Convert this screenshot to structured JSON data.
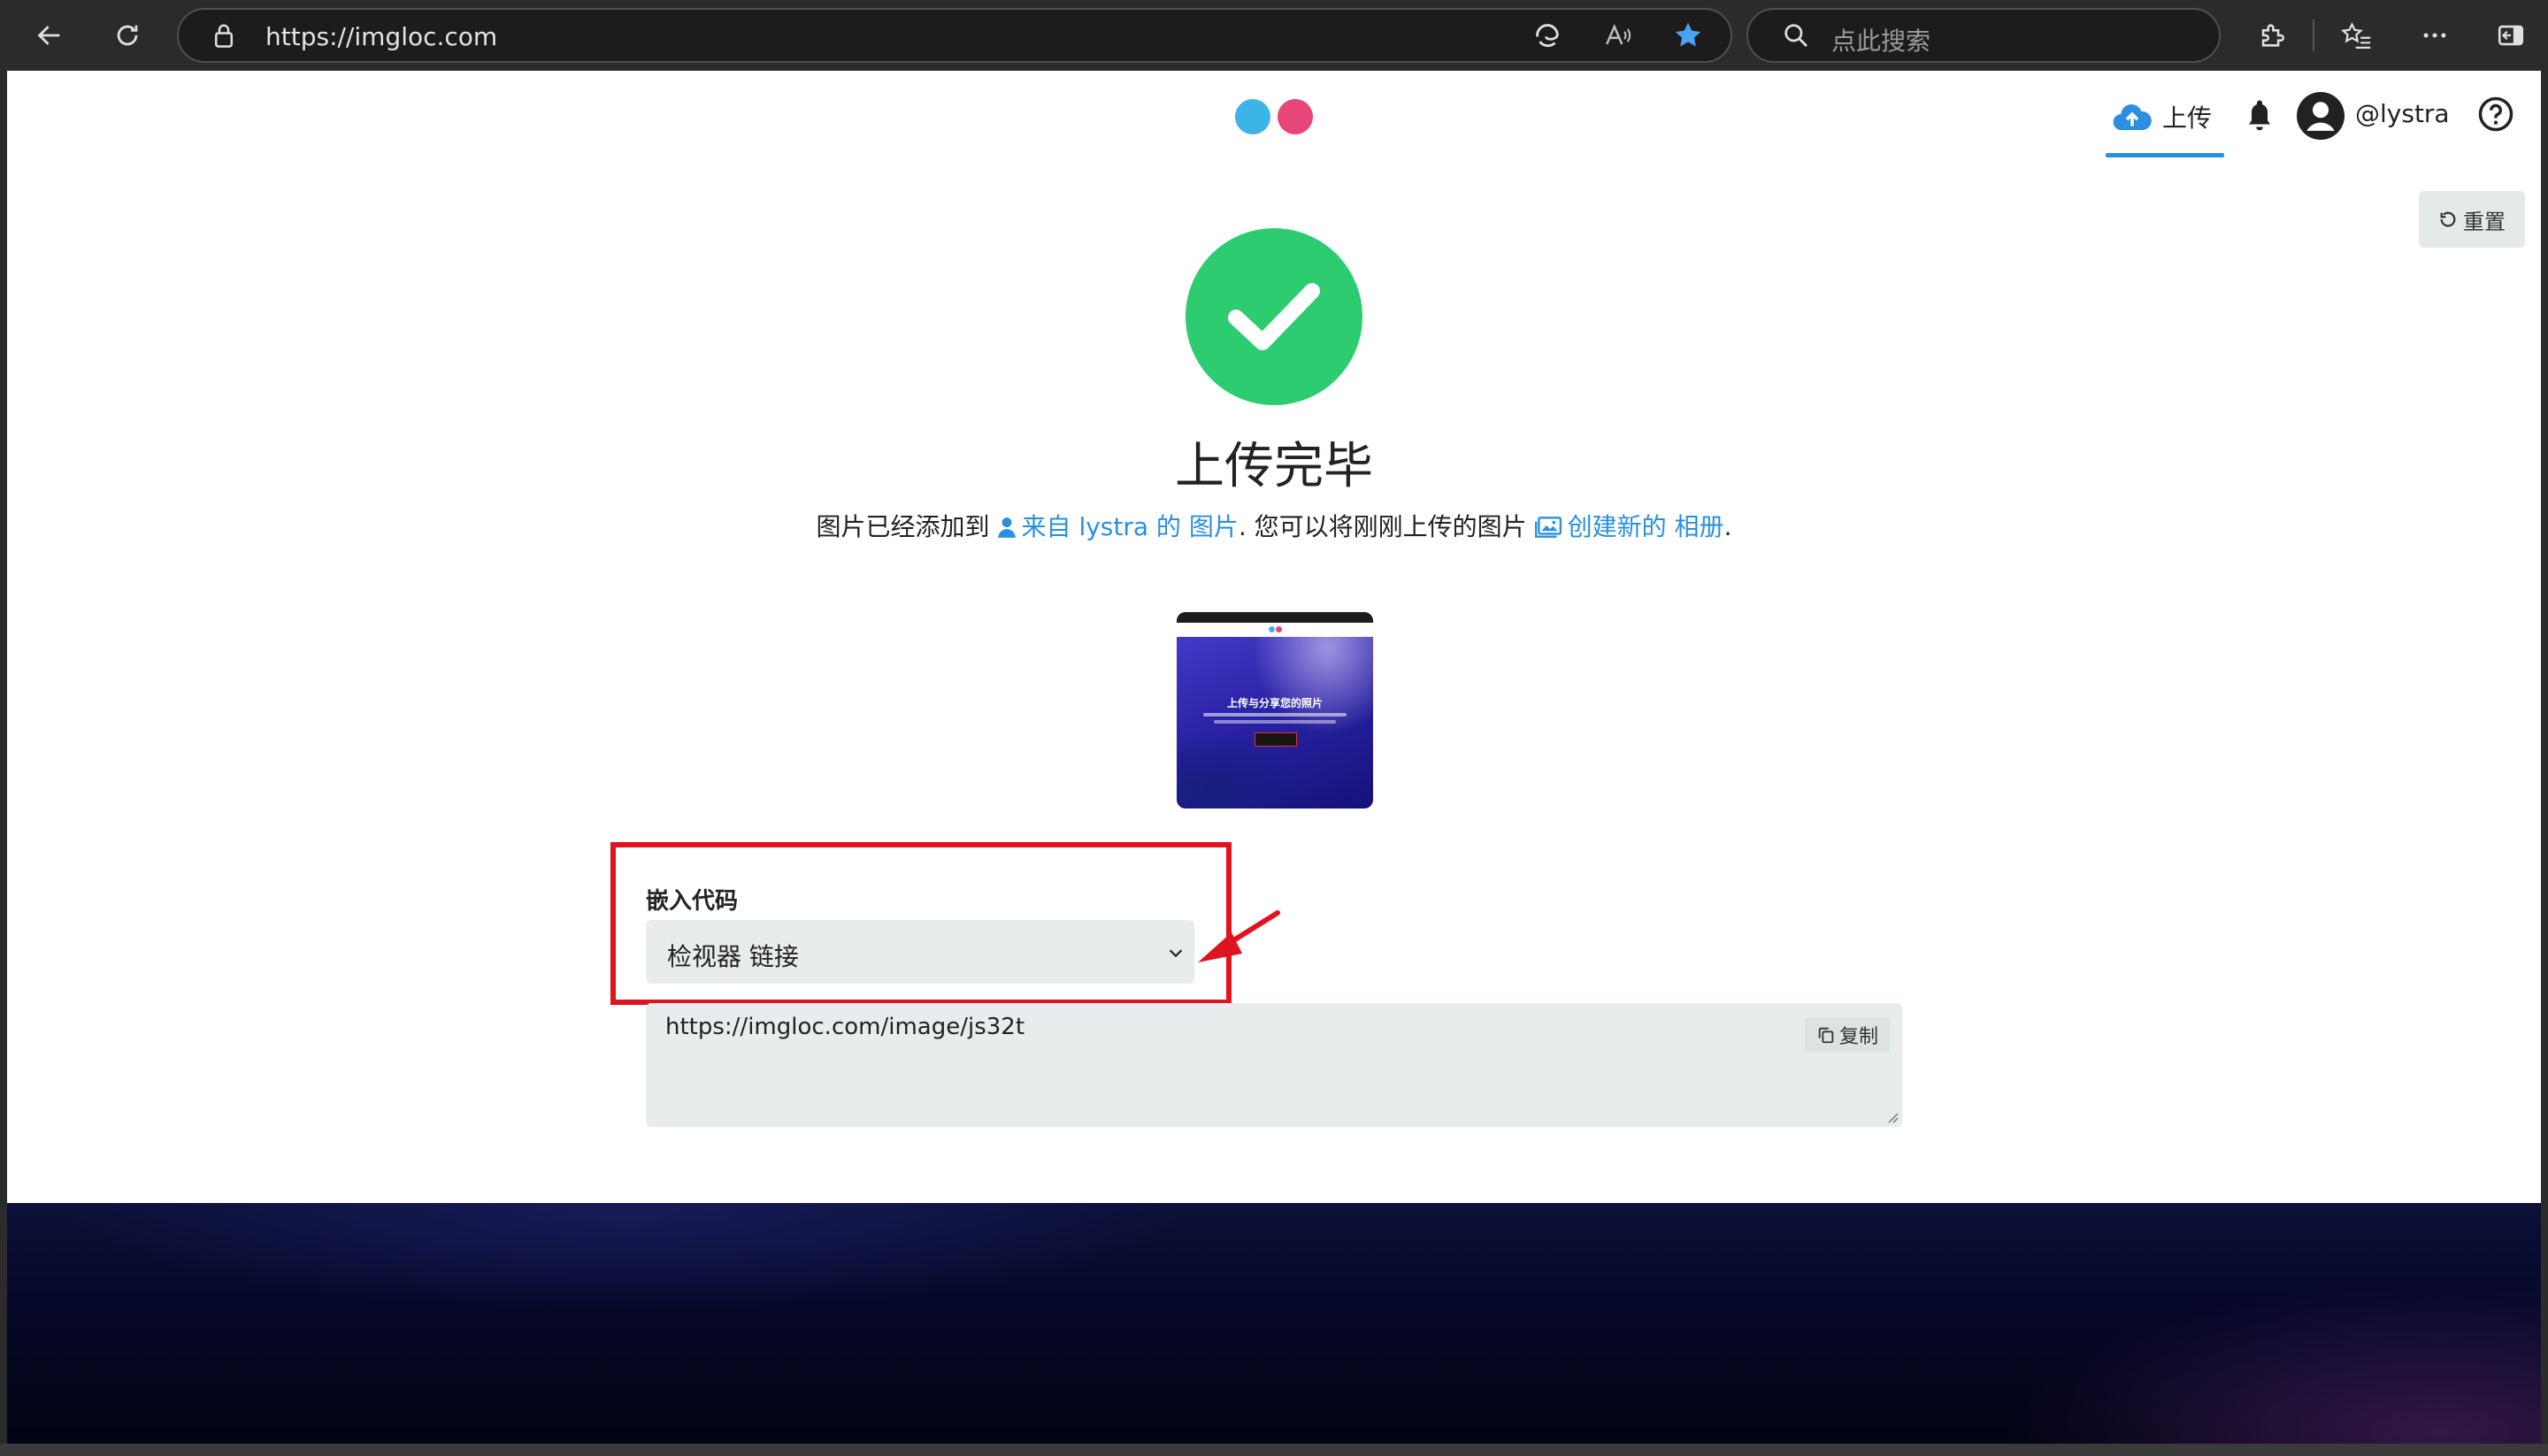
{
  "browser": {
    "url": "https://imgloc.com",
    "search_placeholder": "点此搜索"
  },
  "header": {
    "upload_label": "上传",
    "username": "@lystra",
    "logo_colors": [
      "#3cb4e8",
      "#e8457a"
    ]
  },
  "reset_label": "重置",
  "status": {
    "title": "上传完毕",
    "desc_prefix": "图片已经添加到",
    "desc_link1": "来自 lystra 的 图片",
    "desc_middle": ". 您可以将刚刚上传的图片",
    "desc_link2": "创建新的 相册",
    "desc_suffix": "."
  },
  "thumbnail": {
    "title": "上传与分享您的照片"
  },
  "embed": {
    "label": "嵌入代码",
    "selected_option": "检视器 链接",
    "code_value": "https://imgloc.com/image/js32t",
    "copy_label": "复制"
  },
  "colors": {
    "accent": "#2a8fe0",
    "success": "#2ecc71",
    "highlight": "#e0141e"
  }
}
